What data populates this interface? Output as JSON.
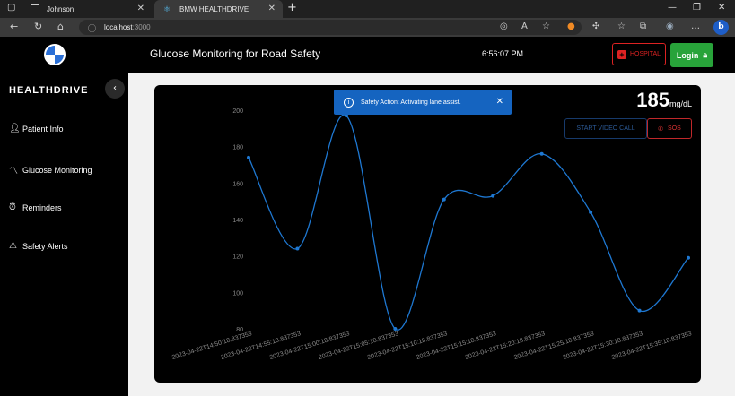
{
  "browser": {
    "tabs": [
      {
        "label": "Johnson",
        "active": false
      },
      {
        "label": "BMW HEALTHDRIVE",
        "active": true
      }
    ],
    "url_host": "localhost",
    "url_port": ":3000"
  },
  "app": {
    "title": "Glucose Monitoring for Road Safety",
    "time": "6:56:07 PM",
    "hospital_label": "HOSPITAL",
    "login_label": "Login",
    "brand": "HEALTHDRIVE",
    "nav": [
      {
        "label": "Patient Info",
        "icon": "person-icon"
      },
      {
        "label": "Glucose Monitoring",
        "icon": "trend-icon"
      },
      {
        "label": "Reminders",
        "icon": "alarm-icon"
      },
      {
        "label": "Safety Alerts",
        "icon": "warning-icon"
      }
    ],
    "toast": "Safety Action: Activating lane assist.",
    "reading_value": "185",
    "reading_unit": "mg/dL",
    "video_call_label": "START VIDEO CALL",
    "sos_label": "SOS"
  },
  "colors": {
    "line": "#1e78d2",
    "hospital": "#dd2222",
    "login": "#28a33a",
    "toast": "#1564c0"
  },
  "chart_data": {
    "type": "line",
    "x": [
      "2023-04-22T14:50:18.837353",
      "2023-04-22T14:55:18.837353",
      "2023-04-22T15:00:18.837353",
      "2023-04-22T15:05:18.837353",
      "2023-04-22T15:10:18.837353",
      "2023-04-22T15:15:18.837353",
      "2023-04-22T15:20:18.837353",
      "2023-04-22T15:25:18.837353",
      "2023-04-22T15:30:18.837353",
      "2023-04-22T15:35:18.837353"
    ],
    "values": [
      174,
      124,
      197,
      80,
      151,
      153,
      176,
      144,
      90,
      119
    ],
    "ylim": [
      80,
      200
    ],
    "yticks": [
      80,
      100,
      120,
      140,
      160,
      180,
      200
    ],
    "grid": false,
    "legend": "none"
  }
}
